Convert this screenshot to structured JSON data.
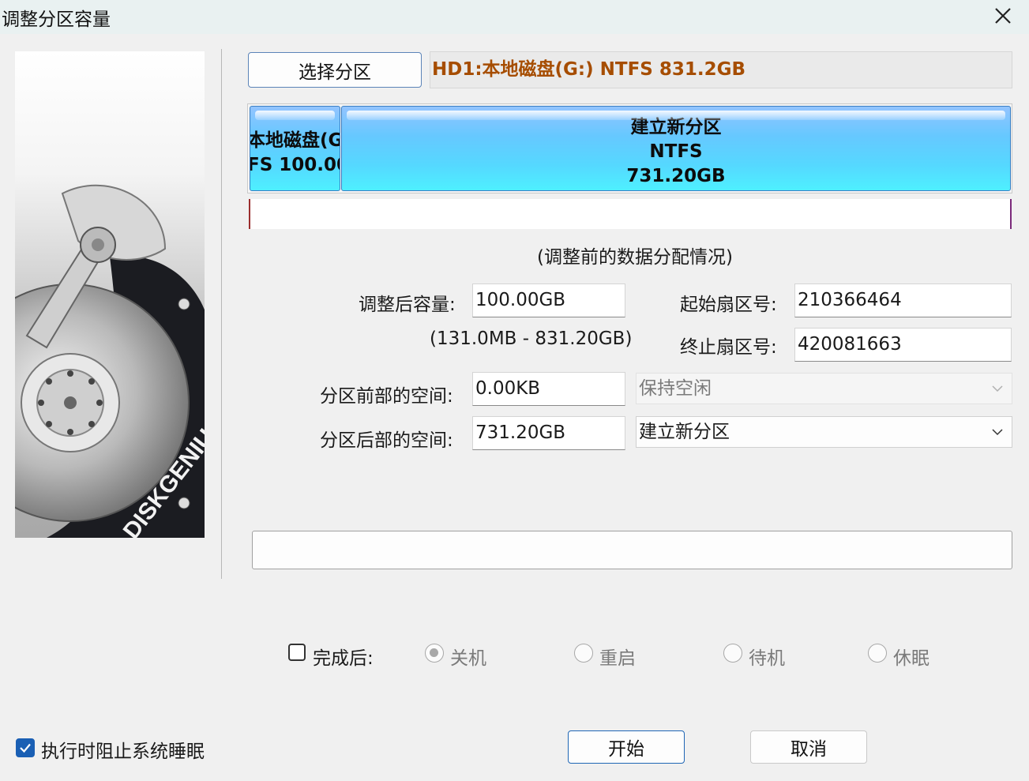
{
  "window": {
    "title": "调整分区容量",
    "close_icon": "close-icon"
  },
  "top": {
    "select_partition_label": "选择分区",
    "partition_header": "HD1:本地磁盘(G:) NTFS 831.2GB",
    "partition_header_color": "#a64d00"
  },
  "partition_map": {
    "existing": {
      "line1": "本地磁盘(G:",
      "line2": "FS 100.00"
    },
    "new": {
      "line1": "建立新分区",
      "line2": "NTFS",
      "line3": "731.20GB"
    },
    "caption": "(调整前的数据分配情况)"
  },
  "form": {
    "size_label": "调整后容量:",
    "size_value": "100.00GB",
    "size_range": "(131.0MB - 831.20GB)",
    "start_sector_label": "起始扇区号:",
    "start_sector_value": "210366464",
    "end_sector_label": "终止扇区号:",
    "end_sector_value": "420081663",
    "before_space_label": "分区前部的空间:",
    "before_space_value": "0.00KB",
    "before_action": "保持空闲",
    "after_space_label": "分区后部的空间:",
    "after_space_value": "731.20GB",
    "after_action": "建立新分区"
  },
  "after_completion": {
    "label": "完成后:",
    "options": [
      "关机",
      "重启",
      "待机",
      "休眠"
    ],
    "selected": "关机"
  },
  "bottom": {
    "prevent_sleep_label": "执行时阻止系统睡眠",
    "start_label": "开始",
    "cancel_label": "取消"
  },
  "colors": {
    "accent": "#1a5fb4",
    "partition_fill": "#55d8ff"
  }
}
